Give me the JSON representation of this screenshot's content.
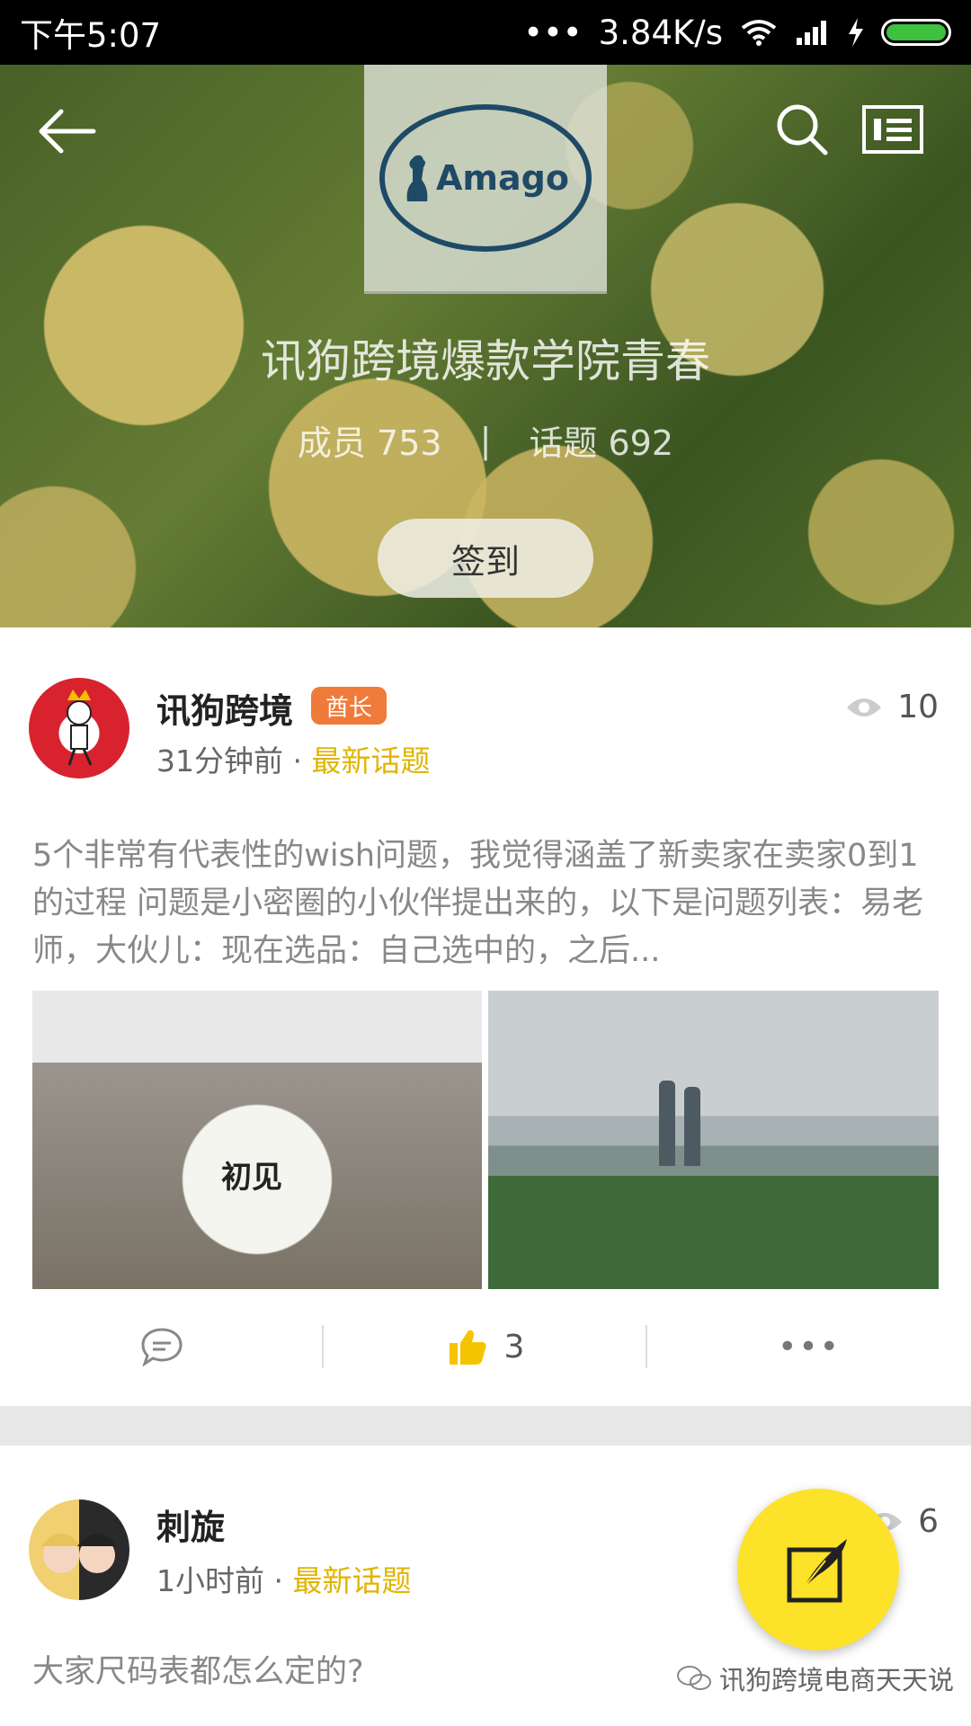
{
  "status_bar": {
    "time": "下午5:07",
    "network_speed": "3.84K/s",
    "dots": "•••",
    "icons": [
      "wifi-icon",
      "signal-icon",
      "charging-icon",
      "battery-icon"
    ],
    "battery_level": 1.0
  },
  "header": {
    "logo_text": "Amago",
    "group_name": "讯狗跨境爆款学院青春",
    "members_label": "成员 753",
    "separator": "|",
    "topics_label": "话题 692",
    "checkin_label": "签到",
    "icons": [
      "back-arrow-icon",
      "search-icon",
      "menu-icon"
    ]
  },
  "posts": [
    {
      "author": "讯狗跨境",
      "badge": "酋长",
      "time": "31分钟前 · ",
      "category": "最新话题",
      "views": "10",
      "text": "5个非常有代表性的wish问题，我觉得涵盖了新卖家在卖家0到1的过程 问题是小密圈的小伙伴提出来的，以下是问题列表：易老师，大伙儿：现在选品：自己选中的，之后...",
      "image1_text": "初见",
      "likes": "3",
      "more": "•••"
    },
    {
      "author": "刺旋",
      "time": "1小时前 · ",
      "category": "最新话题",
      "views": "6",
      "text": "大家尺码表都怎么定的?"
    }
  ],
  "watermark": "讯狗跨境电商天天说",
  "colors": {
    "accent_yellow": "#fde22a",
    "category_yellow": "#e0b500",
    "badge_orange": "#f07a3a"
  }
}
